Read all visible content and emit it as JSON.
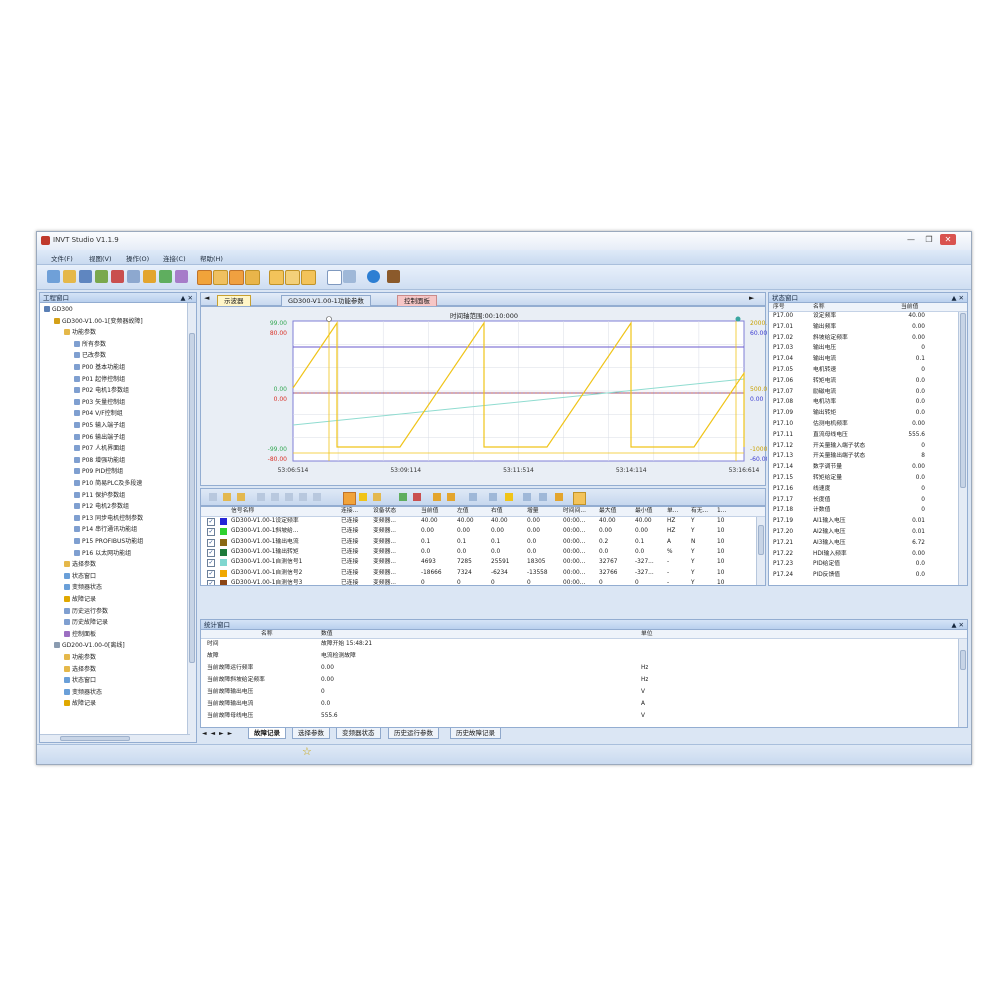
{
  "window": {
    "title": "INVT Studio V1.1.9",
    "controls": [
      "—",
      "❐",
      "✕"
    ]
  },
  "menu": [
    "文件(F)",
    "视图(V)",
    "操作(O)",
    "连接(C)",
    "帮助(H)"
  ],
  "project": {
    "header": "工程窗口",
    "header_controls": "▲ ✕",
    "tree": [
      {
        "label": "GD300",
        "level": 0,
        "icon": "computer-icon",
        "color": "#5a7fb5"
      },
      {
        "label": "GD300-V1.00-1[变频器故障]",
        "level": 1,
        "icon": "drive-icon",
        "color": "#d4a017"
      },
      {
        "label": "功能参数",
        "level": 2,
        "icon": "folder-icon",
        "color": "#e5b84a"
      },
      {
        "label": "所有参数",
        "level": 3,
        "icon": "list-icon",
        "color": "#7f9fd0"
      },
      {
        "label": "已改参数",
        "level": 3,
        "icon": "list-icon",
        "color": "#7f9fd0"
      },
      {
        "label": "P00 基本功能组",
        "level": 3,
        "icon": "list-icon",
        "color": "#7f9fd0"
      },
      {
        "label": "P01 起停控制组",
        "level": 3,
        "icon": "list-icon",
        "color": "#7f9fd0"
      },
      {
        "label": "P02 电机1参数组",
        "level": 3,
        "icon": "list-icon",
        "color": "#7f9fd0"
      },
      {
        "label": "P03 矢量控制组",
        "level": 3,
        "icon": "list-icon",
        "color": "#7f9fd0"
      },
      {
        "label": "P04 V/F控制组",
        "level": 3,
        "icon": "list-icon",
        "color": "#7f9fd0"
      },
      {
        "label": "P05 输入端子组",
        "level": 3,
        "icon": "list-icon",
        "color": "#7f9fd0"
      },
      {
        "label": "P06 输出端子组",
        "level": 3,
        "icon": "list-icon",
        "color": "#7f9fd0"
      },
      {
        "label": "P07 人机界面组",
        "level": 3,
        "icon": "list-icon",
        "color": "#7f9fd0"
      },
      {
        "label": "P08 增强功能组",
        "level": 3,
        "icon": "list-icon",
        "color": "#7f9fd0"
      },
      {
        "label": "P09 PID控制组",
        "level": 3,
        "icon": "list-icon",
        "color": "#7f9fd0"
      },
      {
        "label": "P10 简易PLC及多段速",
        "level": 3,
        "icon": "list-icon",
        "color": "#7f9fd0"
      },
      {
        "label": "P11 保护参数组",
        "level": 3,
        "icon": "list-icon",
        "color": "#7f9fd0"
      },
      {
        "label": "P12 电机2参数组",
        "level": 3,
        "icon": "list-icon",
        "color": "#7f9fd0"
      },
      {
        "label": "P13 同步电机控制参数",
        "level": 3,
        "icon": "list-icon",
        "color": "#7f9fd0"
      },
      {
        "label": "P14 串行通讯功能组",
        "level": 3,
        "icon": "list-icon",
        "color": "#7f9fd0"
      },
      {
        "label": "P15 PROFIBUS功能组",
        "level": 3,
        "icon": "list-icon",
        "color": "#7f9fd0"
      },
      {
        "label": "P16 以太网功能组",
        "level": 3,
        "icon": "list-icon",
        "color": "#7f9fd0"
      },
      {
        "label": "选择参数",
        "level": 2,
        "icon": "folder-icon",
        "color": "#e5b84a"
      },
      {
        "label": "状态窗口",
        "level": 2,
        "icon": "window-icon",
        "color": "#6a9fd8"
      },
      {
        "label": "变频器状态",
        "level": 2,
        "icon": "window-icon",
        "color": "#6a9fd8"
      },
      {
        "label": "故障记录",
        "level": 2,
        "icon": "warning-icon",
        "color": "#e0a800"
      },
      {
        "label": "历史运行参数",
        "level": 2,
        "icon": "list-icon",
        "color": "#7f9fd0"
      },
      {
        "label": "历史故障记录",
        "level": 2,
        "icon": "list-icon",
        "color": "#7f9fd0"
      },
      {
        "label": "控制面板",
        "level": 2,
        "icon": "panel-icon",
        "color": "#9c6fc2"
      },
      {
        "label": "GD200-V1.00-0[离线]",
        "level": 1,
        "icon": "drive-icon",
        "color": "#8a9bb0"
      },
      {
        "label": "功能参数",
        "level": 2,
        "icon": "folder-icon",
        "color": "#e5b84a"
      },
      {
        "label": "选择参数",
        "level": 2,
        "icon": "folder-icon",
        "color": "#e5b84a"
      },
      {
        "label": "状态窗口",
        "level": 2,
        "icon": "window-icon",
        "color": "#6a9fd8"
      },
      {
        "label": "变频器状态",
        "level": 2,
        "icon": "window-icon",
        "color": "#6a9fd8"
      },
      {
        "label": "故障记录",
        "level": 2,
        "icon": "warning-icon",
        "color": "#e0a800"
      }
    ]
  },
  "doc_tabs": [
    {
      "label": "示波器",
      "active": true
    },
    {
      "label": "GD300-V1.00-1功能参数",
      "active": false
    },
    {
      "label": "控制面板",
      "active": false
    }
  ],
  "scope": {
    "time_range_label": "时间轴范围:00:10:000",
    "left_axis": [
      {
        "label": "99.00",
        "color": "#34a853"
      },
      {
        "label": "80.00",
        "color": "#d93025"
      },
      {
        "label": "0.00",
        "color": "#34a853"
      },
      {
        "label": "0.00",
        "color": "#d93025"
      },
      {
        "label": "-99.00",
        "color": "#34a853"
      },
      {
        "label": "-80.00",
        "color": "#d93025"
      }
    ],
    "right_axis": [
      {
        "label": "2000.0",
        "color": "#c9a100"
      },
      {
        "label": "60.00",
        "color": "#3b3bd1"
      },
      {
        "label": "500.0",
        "color": "#c9a100"
      },
      {
        "label": "0.00",
        "color": "#3b3bd1"
      },
      {
        "label": "-1000.0",
        "color": "#c9a100"
      },
      {
        "label": "-60.00",
        "color": "#3b3bd1"
      }
    ],
    "time_ticks": [
      "53:06:514",
      "53:09:114",
      "53:11:514",
      "53:14:114",
      "53:16:614"
    ],
    "colors": {
      "sawtooth": "#f0c419",
      "purple": "#6a5acd",
      "red": "#b85a5a",
      "ramp": "#8fdcd0",
      "grid": "#d8dce6"
    }
  },
  "channels": {
    "headers": [
      "信号名称",
      "连接...",
      "设备状态",
      "当前值",
      "左值",
      "右值",
      "增量",
      "时间间...",
      "最大值",
      "最小值",
      "单...",
      "有无...",
      "1..."
    ],
    "rows": [
      {
        "checked": "✓",
        "color": "#2424d6",
        "cells": [
          "GD300-V1.00-1设定频率",
          "已连接",
          "变频器...",
          "40.00",
          "40.00",
          "40.00",
          "0.00",
          "00:00...",
          "40.00",
          "40.00",
          "HZ",
          "Y",
          "10"
        ]
      },
      {
        "checked": "✓",
        "color": "#2fd12f",
        "cells": [
          "GD300-V1.00-1斜坡给...",
          "已连接",
          "变频器...",
          "0.00",
          "0.00",
          "0.00",
          "0.00",
          "00:00...",
          "0.00",
          "0.00",
          "HZ",
          "Y",
          "10"
        ]
      },
      {
        "checked": "✓",
        "color": "#8b6914",
        "cells": [
          "GD300-V1.00-1输出电流",
          "已连接",
          "变频器...",
          "0.1",
          "0.1",
          "0.1",
          "0.0",
          "00:00...",
          "0.2",
          "0.1",
          "A",
          "N",
          "10"
        ]
      },
      {
        "checked": "✓",
        "color": "#1e7a3a",
        "cells": [
          "GD300-V1.00-1输出转矩",
          "已连接",
          "变频器...",
          "0.0",
          "0.0",
          "0.0",
          "0.0",
          "00:00...",
          "0.0",
          "0.0",
          "%",
          "Y",
          "10"
        ]
      },
      {
        "checked": "✓",
        "color": "#7fd7d0",
        "cells": [
          "GD300-V1.00-1自测信号1",
          "已连接",
          "变频器...",
          "4693",
          "7285",
          "25591",
          "18305",
          "00:00...",
          "32767",
          "-327...",
          "-",
          "Y",
          "10"
        ]
      },
      {
        "checked": "✓",
        "color": "#f0a800",
        "cells": [
          "GD300-V1.00-1自测信号2",
          "已连接",
          "变频器...",
          "-18666",
          "7324",
          "-6234",
          "-13558",
          "00:00...",
          "32766",
          "-327...",
          "-",
          "Y",
          "10"
        ]
      },
      {
        "checked": "✓",
        "color": "#8b4513",
        "cells": [
          "GD300-V1.00-1自测信号3",
          "已连接",
          "变频器...",
          "0",
          "0",
          "0",
          "0",
          "00:00...",
          "0",
          "0",
          "-",
          "Y",
          "10"
        ]
      }
    ]
  },
  "status_window": {
    "header": "状态窗口",
    "columns": [
      "序号",
      "名称",
      "当前值"
    ],
    "rows": [
      [
        "P17.00",
        "设定频率",
        "40.00"
      ],
      [
        "P17.01",
        "输出频率",
        "0.00"
      ],
      [
        "P17.02",
        "斜坡给定频率",
        "0.00"
      ],
      [
        "P17.03",
        "输出电压",
        "0"
      ],
      [
        "P17.04",
        "输出电流",
        "0.1"
      ],
      [
        "P17.05",
        "电机转速",
        "0"
      ],
      [
        "P17.06",
        "转矩电流",
        "0.0"
      ],
      [
        "P17.07",
        "励磁电流",
        "0.0"
      ],
      [
        "P17.08",
        "电机功率",
        "0.0"
      ],
      [
        "P17.09",
        "输出转矩",
        "0.0"
      ],
      [
        "P17.10",
        "估测电机频率",
        "0.00"
      ],
      [
        "P17.11",
        "直流母线电压",
        "555.6"
      ],
      [
        "P17.12",
        "开关量输入端子状态",
        "0"
      ],
      [
        "P17.13",
        "开关量输出端子状态",
        "8"
      ],
      [
        "P17.14",
        "数字调节量",
        "0.00"
      ],
      [
        "P17.15",
        "转矩给定量",
        "0.0"
      ],
      [
        "P17.16",
        "线速度",
        "0"
      ],
      [
        "P17.17",
        "长度值",
        "0"
      ],
      [
        "P17.18",
        "计数值",
        "0"
      ],
      [
        "P17.19",
        "AI1输入电压",
        "0.01"
      ],
      [
        "P17.20",
        "AI2输入电压",
        "0.01"
      ],
      [
        "P17.21",
        "AI3输入电压",
        "6.72"
      ],
      [
        "P17.22",
        "HDI输入频率",
        "0.00"
      ],
      [
        "P17.23",
        "PID给定值",
        "0.0"
      ],
      [
        "P17.24",
        "PID反馈值",
        "0.0"
      ]
    ]
  },
  "stats_window": {
    "header": "统计窗口",
    "columns": [
      "名称",
      "数值",
      "单位"
    ],
    "rows": [
      [
        "时间",
        "故障开始 15:48:21",
        ""
      ],
      [
        "故障",
        "电流检测故障",
        ""
      ],
      [
        "当前故障运行频率",
        "0.00",
        "Hz"
      ],
      [
        "当前故障斜坡给定频率",
        "0.00",
        "Hz"
      ],
      [
        "当前故障输出电压",
        "0",
        "V"
      ],
      [
        "当前故障输出电流",
        "0.0",
        "A"
      ],
      [
        "当前故障母线电压",
        "555.6",
        "V"
      ]
    ]
  },
  "bottom_tabs": [
    "故障记录",
    "选择参数",
    "变频器状态",
    "历史运行参数",
    "历史故障记录"
  ],
  "bottom_nav": "◄ ◄ ► ►"
}
